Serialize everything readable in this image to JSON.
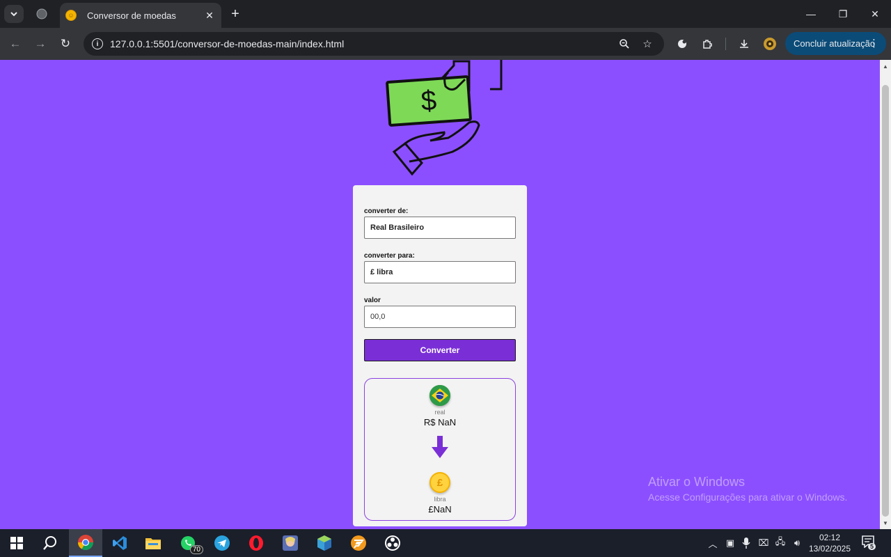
{
  "browser": {
    "tab_title": "Conversor de moedas",
    "url": "127.0.0.1:5501/conversor-de-moedas-main/index.html",
    "update_button": "Concluir atualização"
  },
  "form": {
    "from_label": "converter de:",
    "from_value": "Real Brasileiro",
    "to_label": "converter para:",
    "to_value": "£ libra",
    "amount_label": "valor",
    "amount_placeholder": "00,0",
    "convert_button": "Converter"
  },
  "result": {
    "source_name": "real",
    "source_value": "R$ NaN",
    "target_name": "libra",
    "target_value": "£NaN",
    "target_symbol": "£"
  },
  "watermark": {
    "line1": "Ativar o Windows",
    "line2": "Acesse Configurações para ativar o Windows."
  },
  "taskbar": {
    "whatsapp_badge": "70",
    "time": "02:12",
    "date": "13/02/2025",
    "notification_count": "5"
  },
  "colors": {
    "page_background": "#8c4fff",
    "accent": "#7a2fd6",
    "bill_green": "#7ed957"
  }
}
